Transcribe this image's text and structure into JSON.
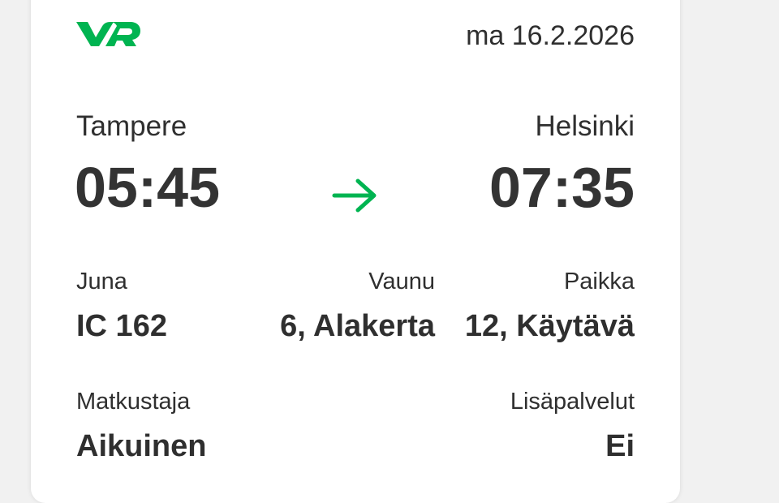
{
  "brand": {
    "logo_icon": "vr-logo-icon",
    "accent_color": "#00b451"
  },
  "ticket": {
    "date": "ma 16.2.2026",
    "origin": {
      "station": "Tampere",
      "time": "05:45"
    },
    "destination": {
      "station": "Helsinki",
      "time": "07:35"
    },
    "direction_icon": "arrow-right-icon",
    "details": {
      "train": {
        "label": "Juna",
        "value": "IC 162"
      },
      "car": {
        "label": "Vaunu",
        "value": "6, Alakerta"
      },
      "seat": {
        "label": "Paikka",
        "value": "12, Käytävä"
      },
      "passenger": {
        "label": "Matkustaja",
        "value": "Aikuinen"
      },
      "extras": {
        "label": "Lisäpalvelut",
        "value": "Ei"
      }
    }
  }
}
